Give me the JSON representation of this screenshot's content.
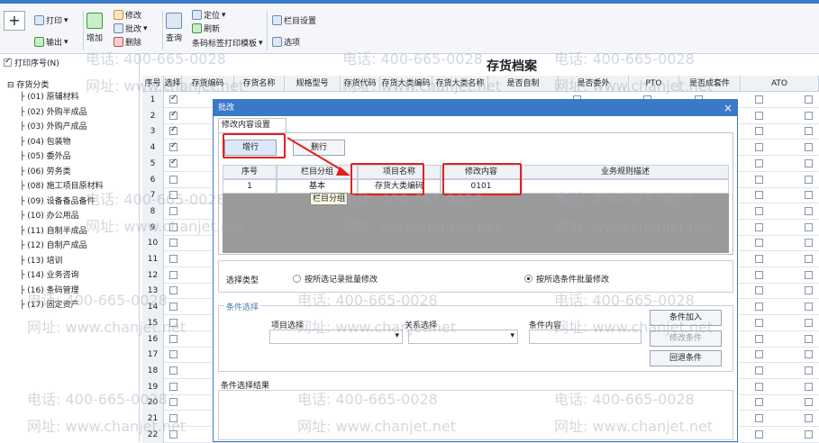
{
  "toolbar": {
    "print": "打印",
    "output": "输出",
    "edit": "修改",
    "batch": "批改",
    "delete": "删除",
    "add": "增加",
    "query": "查询",
    "locate": "定位",
    "refresh": "刷新",
    "barcode": "条码标签打印模板",
    "column_settings": "栏目设置",
    "options": "选项"
  },
  "left": {
    "print_seq": "打印序号(N)",
    "root": "存货分类",
    "items": [
      "(01) 原辅材料",
      "(02) 外购半成品",
      "(03) 外购产成品",
      "(04) 包装物",
      "(05) 委外品",
      "(06) 劳务类",
      "(08) 施工项目原材料",
      "(09) 设备备品备件",
      "(10) 办公用品",
      "(11) 自制半成品",
      "(12) 自制产成品",
      "(13) 培训",
      "(14) 业务咨询",
      "(16) 条码管理",
      "(17) 固定资产"
    ]
  },
  "page_title": "存货档案",
  "grid": {
    "headers": [
      "序号",
      "选择",
      "存货编码",
      "存货名称",
      "规格型号",
      "存货代码",
      "存货大类编码",
      "存货大类名称",
      "是否自制",
      "是否委外",
      "PTO",
      "是否成套件",
      "ATO"
    ],
    "rows": [
      "1",
      "2",
      "3",
      "4",
      "5",
      "6",
      "7",
      "8",
      "9",
      "10",
      "11",
      "12",
      "13",
      "14",
      "15",
      "16",
      "17",
      "18",
      "19",
      "20",
      "21",
      "22"
    ],
    "checked": [
      true,
      true,
      true,
      true,
      true,
      false,
      false,
      false,
      false,
      false,
      false,
      false,
      false,
      false,
      false,
      false,
      false,
      false,
      false,
      false,
      false,
      false
    ]
  },
  "dialog": {
    "title": "批改",
    "tab": "修改内容设置",
    "add_row": "增行",
    "delete_row": "删行",
    "table_headers": [
      "序号",
      "栏目分组",
      "项目名称",
      "修改内容",
      "业务规则描述"
    ],
    "row": {
      "seq": "1",
      "group": "基本",
      "item": "存货大类编码",
      "value": "0101",
      "desc": ""
    },
    "tooltip": "栏目分组",
    "select_type_label": "选择类型",
    "option1": "按所选记录批量修改",
    "option2": "按所选条件批量修改",
    "condition_title": "条件选择",
    "field_select": "项目选择",
    "relation_select": "关系选择",
    "condition_content": "条件内容",
    "cond_add": "条件加入",
    "cond_edit": "修改条件",
    "cond_remove": "回退条件",
    "result_label": "条件选择结果"
  },
  "watermark": {
    "phone": "电话: 400-665-0028",
    "site": "网址: www.chanjet.net"
  },
  "colors": {
    "accent": "#3a79c8",
    "highlight": "#e0231f"
  }
}
